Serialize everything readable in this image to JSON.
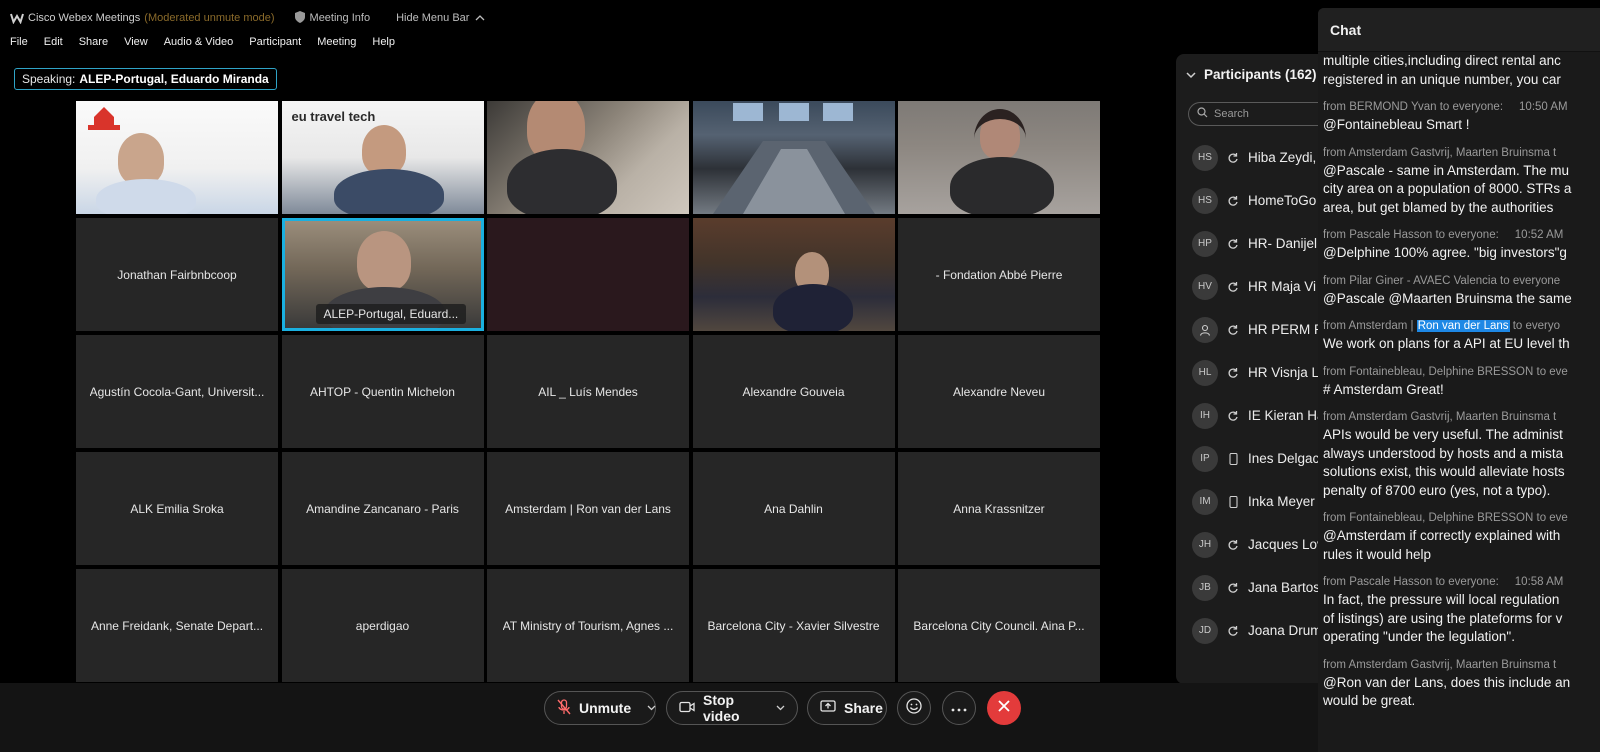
{
  "titlebar": {
    "app_name": "Cisco Webex Meetings",
    "mode": "(Moderated unmute mode)",
    "meeting_info": "Meeting Info",
    "hide_menu": "Hide Menu Bar"
  },
  "menu": [
    "File",
    "Edit",
    "Share",
    "View",
    "Audio & Video",
    "Participant",
    "Meeting",
    "Help"
  ],
  "speaking": {
    "label": "Speaking:",
    "name": "ALEP-Portugal, Eduardo Miranda"
  },
  "grid": {
    "tile2_logo_text": "eu travel tech",
    "active_speaker_chip": "ALEP-Portugal, Eduard...",
    "names": [
      "Jonathan Fairbnbcoop",
      "- Fondation Abbé Pierre",
      "Agustín Cocola-Gant, Universit...",
      "AHTOP - Quentin Michelon",
      "AIL _ Luís Mendes",
      "Alexandre Gouveia",
      "Alexandre Neveu",
      "ALK Emilia Sroka",
      "Amandine Zancanaro - Paris",
      "Amsterdam | Ron van der Lans",
      "Ana Dahlin",
      "Anna Krassnitzer",
      "Anne Freidank, Senate Depart...",
      "aperdigao",
      "AT Ministry of Tourism, Agnes ...",
      "Barcelona City - Xavier Silvestre",
      "Barcelona City Council. Aina P..."
    ]
  },
  "participants": {
    "title": "Participants (162)",
    "search_placeholder": "Search",
    "rows": [
      {
        "initials": "HS",
        "name": "Hiba Zeydi,",
        "icon": "sync-icon"
      },
      {
        "initials": "HS",
        "name": "HomeToGo",
        "icon": "sync-icon"
      },
      {
        "initials": "HP",
        "name": "HR- Danijel",
        "icon": "sync-icon"
      },
      {
        "initials": "HV",
        "name": "HR Maja Vi",
        "icon": "sync-icon"
      },
      {
        "initials": "",
        "name": "HR PERM R",
        "icon": "sync-icon"
      },
      {
        "initials": "HL",
        "name": "HR Visnja L",
        "icon": "sync-icon"
      },
      {
        "initials": "IH",
        "name": "IE Kieran Ha",
        "icon": "sync-icon"
      },
      {
        "initials": "IP",
        "name": "Ines Delgac",
        "icon": "phone-icon"
      },
      {
        "initials": "IM",
        "name": "Inka Meyer",
        "icon": "phone-icon"
      },
      {
        "initials": "JH",
        "name": "Jacques Lov",
        "icon": "sync-icon"
      },
      {
        "initials": "JB",
        "name": "Jana Bartos",
        "icon": "sync-icon"
      },
      {
        "initials": "JD",
        "name": "Joana Drum",
        "icon": "sync-icon"
      }
    ]
  },
  "chat": {
    "title": "Chat",
    "messages": [
      {
        "meta": "",
        "time": "",
        "lines": [
          "multiple cities,including direct rental anc",
          "registered in an unique number, you car"
        ]
      },
      {
        "meta": "from BERMOND Yvan to everyone:",
        "time": "10:50 AM",
        "lines": [
          "@Fontainebleau Smart !"
        ]
      },
      {
        "meta": "from Amsterdam Gastvrij, Maarten Bruinsma t",
        "time": "",
        "lines": [
          "@Pascale - same in Amsterdam. The mu",
          "city area on a population of 8000. STRs a",
          "area, but get blamed by the authorities"
        ]
      },
      {
        "meta": "from Pascale Hasson to everyone:",
        "time": "10:52 AM",
        "lines": [
          "@Delphine 100% agree. \"big investors\"g"
        ]
      },
      {
        "meta": "from Pilar Giner - AVAEC Valencia to everyone",
        "time": "",
        "lines": [
          "@Pascale @Maarten Bruinsma the same"
        ]
      },
      {
        "meta": "",
        "time": "",
        "lines": [
          "We work on plans for a API at EU level th"
        ]
      },
      {
        "meta": "from Fontainebleau, Delphine BRESSON to eve",
        "time": "",
        "lines": [
          "# Amsterdam Great!"
        ]
      },
      {
        "meta": "from Amsterdam Gastvrij, Maarten Bruinsma t",
        "time": "",
        "lines": [
          "APIs would be very useful. The administ",
          "always understood by hosts and a mista",
          "solutions exist, this would alleviate hosts",
          "penalty of 8700 euro (yes, not a typo)."
        ]
      },
      {
        "meta": "from Fontainebleau, Delphine BRESSON to eve",
        "time": "",
        "lines": [
          "@Amsterdam if correctly explained with",
          "rules it would help"
        ]
      },
      {
        "meta": "from Pascale Hasson to everyone:",
        "time": "10:58 AM",
        "lines": [
          "In fact, the pressure will local regulation",
          "of listings) are using the plateforms for v",
          "operating \"under the legulation\"."
        ]
      },
      {
        "meta": "from Amsterdam Gastvrij, Maarten Bruinsma t",
        "time": "",
        "lines": [
          "@Ron van der Lans, does this include an",
          "would be great."
        ]
      }
    ],
    "highlight_meta": {
      "prefix": "from Amsterdam | ",
      "highlight": "Ron van der Lans",
      "suffix": " to everyo"
    }
  },
  "controls": {
    "unmute": "Unmute",
    "stop_video": "Stop video",
    "share": "Share"
  },
  "colors": {
    "accent": "#1ab0e0",
    "end": "#e33b3b",
    "highlight": "#1e88e5"
  }
}
